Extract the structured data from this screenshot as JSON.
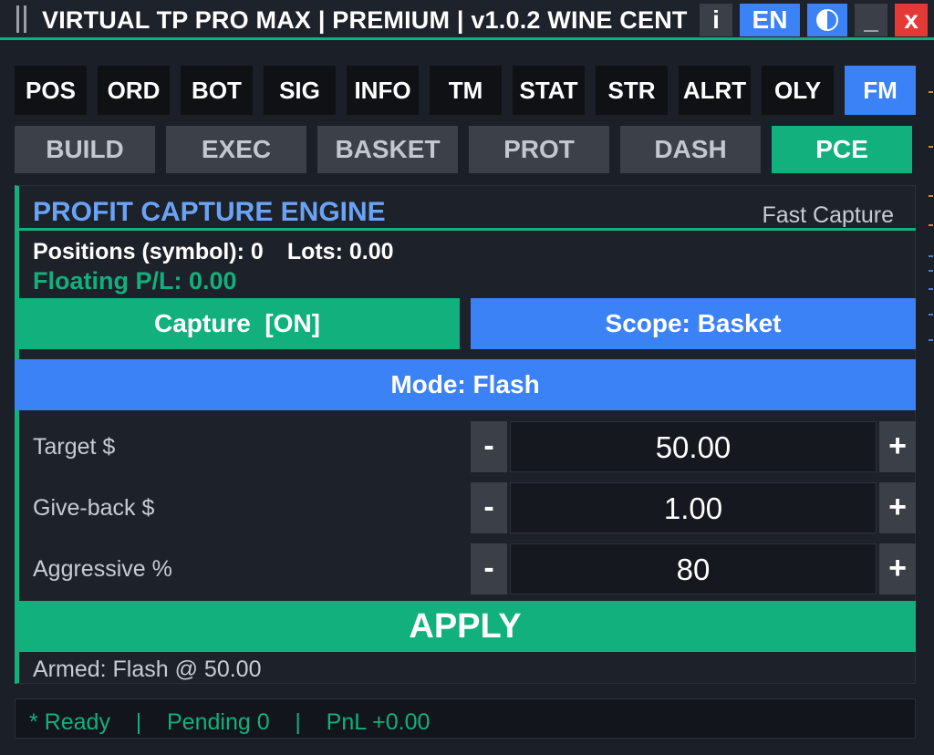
{
  "window": {
    "title": "VIRTUAL TP PRO MAX | PREMIUM | v1.0.2 WINE  CENT",
    "info_label": "i",
    "lang_label": "EN",
    "minimize_label": "_",
    "close_label": "x"
  },
  "nav_tabs": [
    {
      "label": "POS"
    },
    {
      "label": "ORD"
    },
    {
      "label": "BOT"
    },
    {
      "label": "SIG"
    },
    {
      "label": "INFO"
    },
    {
      "label": "TM"
    },
    {
      "label": "STAT"
    },
    {
      "label": "STR"
    },
    {
      "label": "ALRT"
    },
    {
      "label": "OLY"
    },
    {
      "label": "FM",
      "active": true
    }
  ],
  "sub_tabs": [
    {
      "label": "BUILD"
    },
    {
      "label": "EXEC"
    },
    {
      "label": "BASKET"
    },
    {
      "label": "PROT"
    },
    {
      "label": "DASH"
    },
    {
      "label": "PCE",
      "active": true
    }
  ],
  "panel": {
    "title": "PROFIT CAPTURE ENGINE",
    "subtitle": "Fast Capture",
    "positions_label": "Positions (symbol): 0",
    "lots_label": "Lots: 0.00",
    "floating_label": "Floating P/L: 0.00",
    "capture_button": "Capture  [ON]",
    "scope_button": "Scope: Basket",
    "mode_button": "Mode: Flash",
    "fields": [
      {
        "label": "Target $",
        "value": "50.00"
      },
      {
        "label": "Give-back $",
        "value": "1.00"
      },
      {
        "label": "Aggressive %",
        "value": "80"
      }
    ],
    "minus_label": "-",
    "plus_label": "+",
    "apply_button": "APPLY",
    "armed_text": "Armed: Flash @ 50.00"
  },
  "status": {
    "text": "* Ready    |    Pending 0    |    PnL +0.00"
  },
  "colors": {
    "accent_green": "#12b07c",
    "accent_blue": "#3b82f6",
    "title_blue": "#6aa3f5",
    "close_red": "#e53935"
  }
}
